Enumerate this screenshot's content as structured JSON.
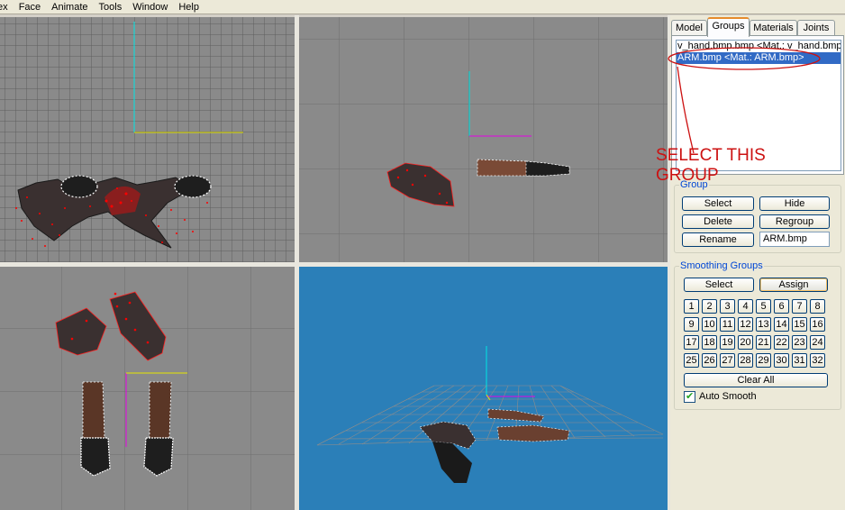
{
  "menu": {
    "items": [
      "tex",
      "Face",
      "Animate",
      "Tools",
      "Window",
      "Help"
    ]
  },
  "tabs": {
    "model": "Model",
    "groups": "Groups",
    "materials": "Materials",
    "joints": "Joints"
  },
  "group_list": {
    "items": [
      "v_hand.bmp.bmp <Mat.: v_hand.bmp.bmp>",
      "ARM.bmp <Mat.: ARM.bmp>"
    ],
    "selected_index": 1
  },
  "group_box": {
    "title": "Group",
    "select_label": "Select",
    "hide_label": "Hide",
    "delete_label": "Delete",
    "regroup_label": "Regroup",
    "rename_label": "Rename",
    "name_value": "ARM.bmp"
  },
  "smoothing": {
    "title": "Smoothing Groups",
    "select_label": "Select",
    "assign_label": "Assign",
    "numbers": [
      "1",
      "2",
      "3",
      "4",
      "5",
      "6",
      "7",
      "8",
      "9",
      "10",
      "11",
      "12",
      "13",
      "14",
      "15",
      "16",
      "17",
      "18",
      "19",
      "20",
      "21",
      "22",
      "23",
      "24",
      "25",
      "26",
      "27",
      "28",
      "29",
      "30",
      "31",
      "32"
    ],
    "clear_all_label": "Clear All",
    "auto_smooth_label": "Auto Smooth",
    "auto_smooth_checked": true
  },
  "annotation": {
    "text": "SELECT THIS GROUP",
    "color": "#cc1111"
  },
  "colors": {
    "viewport_gray": "#8a8a8a",
    "viewport_3d_blue": "#2b7fb8",
    "selection_blue": "#316ac5",
    "vertex_red": "#ff0000"
  }
}
